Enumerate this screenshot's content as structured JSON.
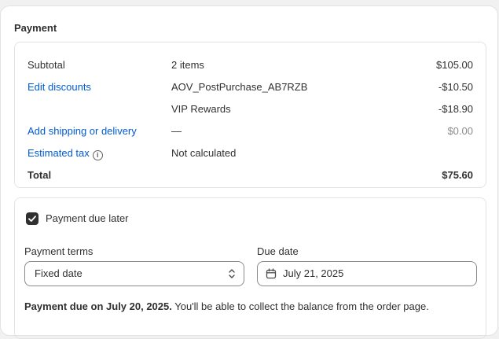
{
  "payment": {
    "title": "Payment",
    "rows": {
      "subtotal": {
        "label": "Subtotal",
        "detail": "2 items",
        "amount": "$105.00"
      },
      "discounts": {
        "label": "Edit discounts",
        "detail": "AOV_PostPurchase_AB7RZB",
        "amount": "-$10.50"
      },
      "vip": {
        "detail": "VIP Rewards",
        "amount": "-$18.90"
      },
      "shipping": {
        "label": "Add shipping or delivery",
        "detail": "—",
        "amount": "$0.00"
      },
      "tax": {
        "label": "Estimated tax",
        "detail": "Not calculated",
        "icon": "info-icon"
      },
      "total": {
        "label": "Total",
        "amount": "$75.60"
      }
    }
  },
  "due_later": {
    "checkbox_label": "Payment due later",
    "checked": true,
    "terms": {
      "label": "Payment terms",
      "value": "Fixed date"
    },
    "due_date": {
      "label": "Due date",
      "value": "July 21, 2025"
    },
    "note_bold": "Payment due on July 20, 2025.",
    "note_rest": " You'll be able to collect the balance from the order page."
  },
  "colors": {
    "link": "#005bd3",
    "text": "#303030",
    "muted": "#8a8a8a"
  }
}
